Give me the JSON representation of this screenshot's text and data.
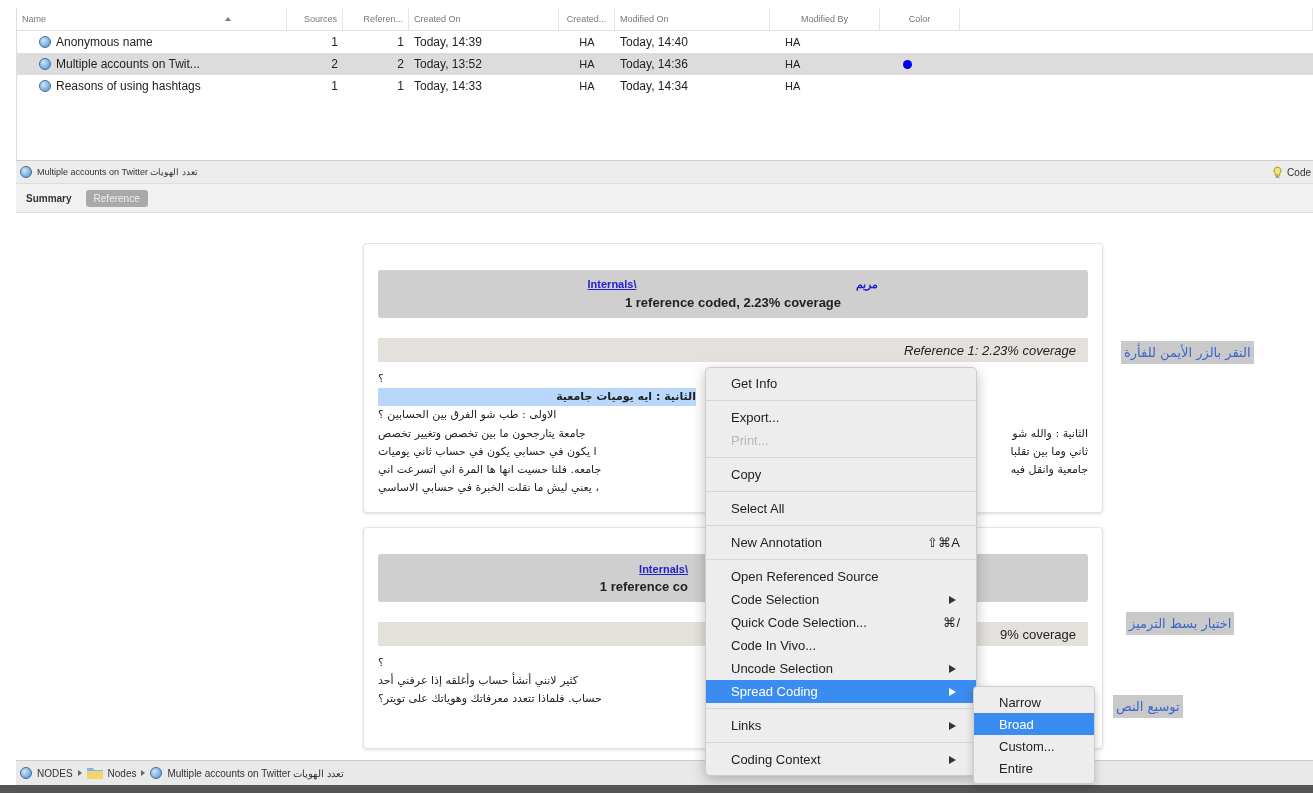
{
  "table": {
    "columns": [
      {
        "label": "Name",
        "sorted": true
      },
      {
        "label": "Sources",
        "sorted": false
      },
      {
        "label": "Referen...",
        "sorted": false
      },
      {
        "label": "Created On",
        "sorted": false
      },
      {
        "label": "Created...",
        "sorted": false
      },
      {
        "label": "Modified On",
        "sorted": false
      },
      {
        "label": "Modified By",
        "sorted": false
      },
      {
        "label": "Color",
        "sorted": false
      }
    ],
    "rows": [
      {
        "name": "Anonymous name",
        "sources": "1",
        "references": "1",
        "created_on": "Today, 14:39",
        "created_by": "HA",
        "modified_on": "Today, 14:40",
        "modified_by": "HA",
        "selected": false
      },
      {
        "name": "Multiple accounts on Twit...",
        "sources": "2",
        "references": "2",
        "created_on": "Today, 13:52",
        "created_by": "HA",
        "modified_on": "Today, 14:36",
        "modified_by": "HA",
        "selected": true,
        "color": "#0000ee"
      },
      {
        "name": "Reasons of using hashtags",
        "sources": "1",
        "references": "1",
        "created_on": "Today, 14:33",
        "created_by": "HA",
        "modified_on": "Today, 14:34",
        "modified_by": "HA",
        "selected": false
      }
    ]
  },
  "path_bar": {
    "title": "Multiple accounts on Twitter تعدد الهويات",
    "action": "Code"
  },
  "tabs": [
    {
      "label": "Summary",
      "selected": false
    },
    {
      "label": "Reference",
      "selected": true
    }
  ],
  "cards": [
    {
      "source_link": "Internals\\",
      "owner": "مريم",
      "summary": "1 reference coded, 2.23% coverage",
      "reference": "Reference 1: 2.23% coverage",
      "clipped": false,
      "lines": [
        {
          "kind": "line",
          "text": "؟",
          "highlighted": false
        },
        {
          "kind": "line",
          "text": "الثانية : ايه يوميات جامعية",
          "highlighted": true
        },
        {
          "kind": "line",
          "text": "الاولى : طب شو الفرق بين الحسابين ؟",
          "highlighted": false
        },
        {
          "kind": "split",
          "left": "جامعة يتارجحون ما بين تخصص وتغيير تخصص",
          "right": "الثانية : والله شو"
        },
        {
          "kind": "split",
          "left": "ا يكون في حسابي يكون في حساب ثاني يوميات",
          "right": "ثاني وما بين تقلبا"
        },
        {
          "kind": "split",
          "left": "جامعه. فلنا حسيت انها ها المرة اني اتسرعت اني",
          "right": "جامعية وانقل فيه"
        },
        {
          "kind": "split",
          "left": "، يعني ليش ما نقلت الخبرة في حسابي الاساسي"
        }
      ]
    },
    {
      "source_link": "Internals\\",
      "summary": "1 reference co",
      "reference": "9% coverage",
      "clipped": true,
      "lines": [
        {
          "kind": "line",
          "text": "؟",
          "highlighted": false
        },
        {
          "kind": "line",
          "text": "كثير لانني أنشأ حساب وأغلقه إذا عرفني أحد",
          "highlighted": false
        },
        {
          "kind": "line",
          "text": "حساب. فلماذا تتعدد معرفاتك وهوياتك على تويتر؟",
          "highlighted": false
        }
      ]
    }
  ],
  "annotations": [
    "النقر بالزر الأيمن للفأرة",
    "اختيار  بسط الترميز",
    "توسيع النص"
  ],
  "context_menu": {
    "groups": [
      [
        {
          "label": "Get Info",
          "disabled": false,
          "selected": false,
          "has_submenu": false
        }
      ],
      [
        {
          "label": "Export...",
          "disabled": false,
          "selected": false,
          "has_submenu": false
        },
        {
          "label": "Print...",
          "disabled": true,
          "selected": false,
          "has_submenu": false
        }
      ],
      [
        {
          "label": "Copy",
          "disabled": false,
          "selected": false,
          "has_submenu": false
        }
      ],
      [
        {
          "label": "Select All",
          "disabled": false,
          "selected": false,
          "has_submenu": false
        }
      ],
      [
        {
          "label": "New Annotation",
          "shortcut": "⇧⌘A",
          "disabled": false,
          "selected": false,
          "has_submenu": false
        }
      ],
      [
        {
          "label": "Open Referenced Source",
          "disabled": false,
          "selected": false,
          "has_submenu": false
        },
        {
          "label": "Code Selection",
          "disabled": false,
          "selected": false,
          "has_submenu": true
        },
        {
          "label": "Quick Code Selection...",
          "shortcut": "⌘/",
          "disabled": false,
          "selected": false,
          "has_submenu": false
        },
        {
          "label": "Code In Vivo...",
          "disabled": false,
          "selected": false,
          "has_submenu": false
        },
        {
          "label": "Uncode Selection",
          "disabled": false,
          "selected": false,
          "has_submenu": true
        },
        {
          "label": "Spread Coding",
          "disabled": false,
          "selected": true,
          "has_submenu": true
        }
      ],
      [
        {
          "label": "Links",
          "disabled": false,
          "selected": false,
          "has_submenu": true
        }
      ],
      [
        {
          "label": "Coding Context",
          "disabled": false,
          "selected": false,
          "has_submenu": true
        }
      ]
    ],
    "submenu": [
      {
        "label": "Narrow",
        "selected": false
      },
      {
        "label": "Broad",
        "selected": true
      },
      {
        "label": "Custom...",
        "selected": false
      },
      {
        "label": "Entire",
        "selected": false
      }
    ]
  },
  "breadcrumbs": [
    {
      "label": "NODES",
      "kind": "node"
    },
    {
      "label": "Nodes",
      "kind": "folder"
    },
    {
      "label": "Multiple accounts on Twitter تعدد الهويات",
      "kind": "node"
    }
  ]
}
